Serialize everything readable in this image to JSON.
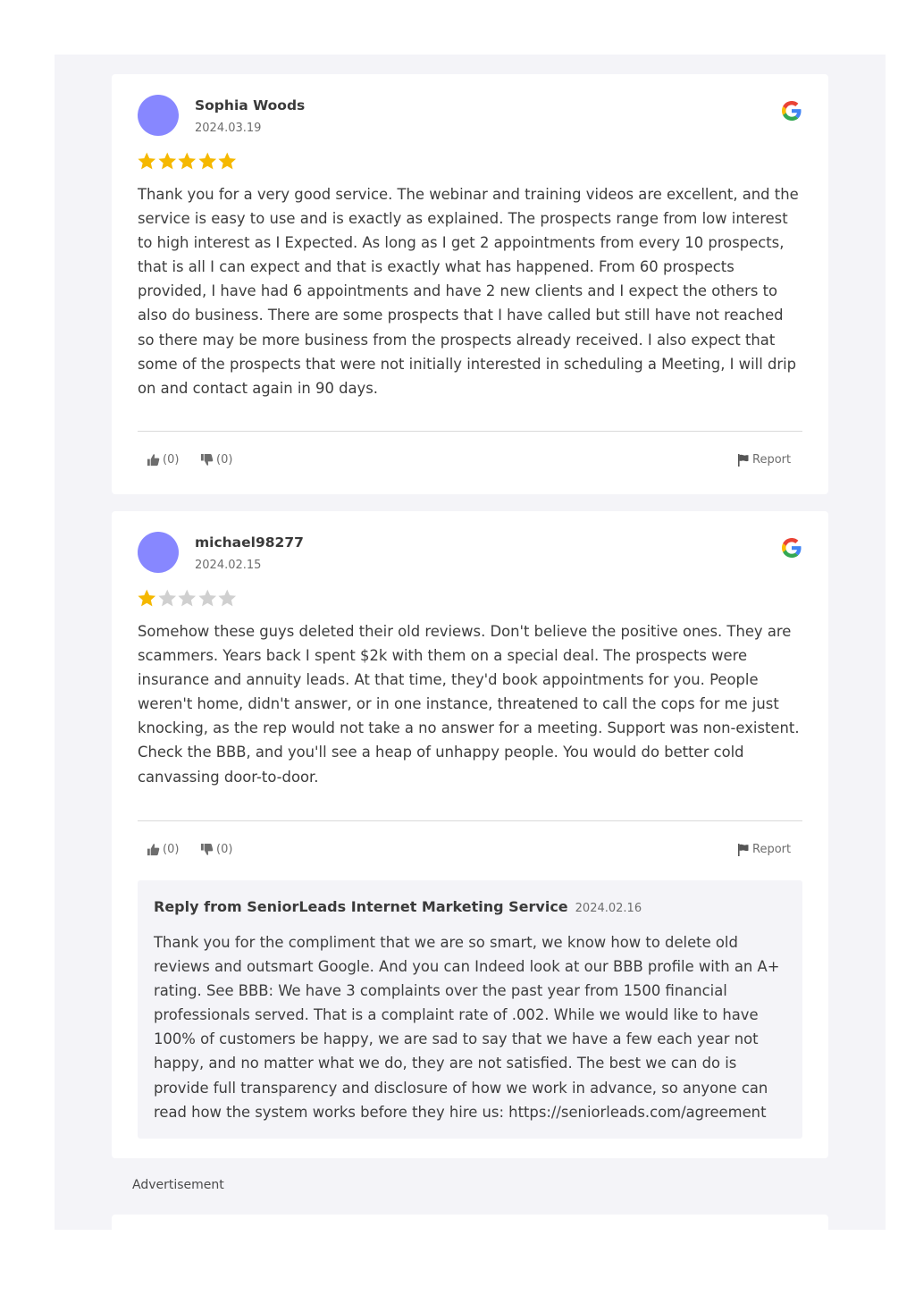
{
  "reviews": [
    {
      "author": "Sophia Woods",
      "date": "2024.03.19",
      "source_icon": "google-icon",
      "rating": 5,
      "rating_max": 5,
      "text": "Thank you for a very good service. The webinar and training videos are excellent, and the service is easy to use and is exactly as explained. The prospects range from low interest to high interest as I Expected. As long as I get 2 appointments from every 10 prospects, that is all I can expect and that is exactly what has happened. From 60 prospects provided, I have had 6 appointments and have 2 new clients and I expect the others to also do business. There are some prospects that I have called but still have not reached so there may be more business from the prospects already received. I also expect that some of the prospects that were not initially interested in scheduling a Meeting, I will drip on and contact again in 90 days.",
      "likes": "(0)",
      "dislikes": "(0)",
      "report_label": "Report"
    },
    {
      "author": "michael98277",
      "date": "2024.02.15",
      "source_icon": "google-icon",
      "rating": 1,
      "rating_max": 5,
      "text": "Somehow these guys deleted their old reviews. Don't believe the positive ones. They are scammers. Years back I spent $2k with them on a special deal. The prospects were insurance and annuity leads. At that time, they'd book appointments for you. People weren't home, didn't answer, or in one instance, threatened to call the cops for me just knocking, as the rep would not take a no answer for a meeting. Support was non-existent. Check the BBB, and you'll see a heap of unhappy people. You would do better cold canvassing door-to-door.",
      "likes": "(0)",
      "dislikes": "(0)",
      "report_label": "Report",
      "reply": {
        "from": "Reply from SeniorLeads Internet Marketing Service",
        "date": "2024.02.16",
        "text": "Thank you for the compliment that we are so smart, we know how to delete old reviews and outsmart Google. And you can Indeed look at our BBB profile with an A+ rating. See BBB: We have 3 complaints over the past year from 1500 financial professionals served. That is a complaint rate of .002. While we would like to have 100% of customers be happy, we are sad to say that we have a few each year not happy, and no matter what we do, they are not satisfied. The best we can do is provide full transparency and disclosure of how we work in advance, so anyone can read how the system works before they hire us: https://seniorleads.com/agreement"
      }
    }
  ],
  "advertisement_label": "Advertisement",
  "colors": {
    "avatar": "#8787ff",
    "star_filled": "#f5b800",
    "star_empty": "#d0d0d0",
    "panel_bg": "#f4f4f8",
    "card_bg": "#ffffff"
  }
}
